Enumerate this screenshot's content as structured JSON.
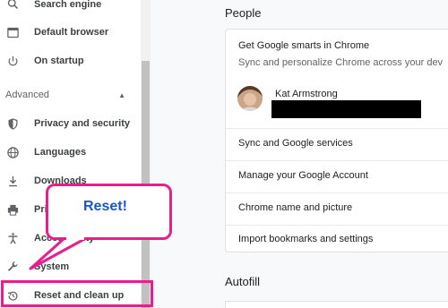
{
  "sidebar": {
    "items": [
      {
        "label": "Search engine",
        "icon": "search-icon"
      },
      {
        "label": "Default browser",
        "icon": "browser-icon"
      },
      {
        "label": "On startup",
        "icon": "power-icon"
      }
    ],
    "advanced_label": "Advanced",
    "advanced_items": [
      {
        "label": "Privacy and security",
        "icon": "shield-icon"
      },
      {
        "label": "Languages",
        "icon": "globe-icon"
      },
      {
        "label": "Downloads",
        "icon": "download-icon"
      },
      {
        "label": "Printing",
        "icon": "printer-icon"
      },
      {
        "label": "Accessibility",
        "icon": "accessibility-icon"
      },
      {
        "label": "System",
        "icon": "wrench-icon"
      },
      {
        "label": "Reset and clean up",
        "icon": "restore-icon"
      }
    ]
  },
  "people": {
    "title": "People",
    "smarts_title": "Get Google smarts in Chrome",
    "smarts_sub": "Sync and personalize Chrome across your dev",
    "user_name": "Kat Armstrong",
    "rows": [
      "Sync and Google services",
      "Manage your Google Account",
      "Chrome name and picture",
      "Import bookmarks and settings"
    ]
  },
  "autofill": {
    "title": "Autofill"
  },
  "annotation": {
    "callout_text": "Reset!",
    "color": "#e91e8c",
    "text_color": "#1a56c8"
  }
}
